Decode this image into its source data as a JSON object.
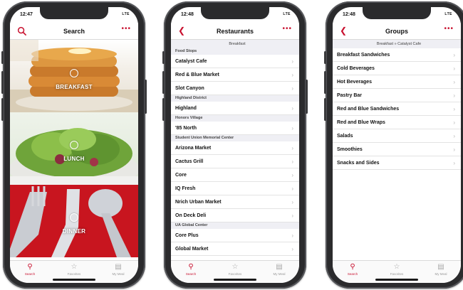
{
  "status": {
    "time_1": "12:47",
    "time_2": "12:48",
    "time_3": "12:48",
    "signal": "LTE"
  },
  "screen1": {
    "title": "Search",
    "meals": [
      {
        "label": "BREAKFAST"
      },
      {
        "label": "LUNCH"
      },
      {
        "label": "DINNER"
      }
    ]
  },
  "screen2": {
    "title": "Restaurants",
    "subheader": "Breakfast",
    "sections": [
      {
        "header": "Food Stops",
        "rows": [
          "Catalyst Cafe",
          "Red & Blue Market",
          "Slot Canyon"
        ]
      },
      {
        "header": "Highland District",
        "rows": [
          "Highland"
        ]
      },
      {
        "header": "Honors Village",
        "rows": [
          "'85 North"
        ]
      },
      {
        "header": "Student Union Memorial Center",
        "rows": [
          "Arizona Market",
          "Cactus Grill",
          "Core",
          "IQ Fresh",
          "Nrich Urban Market",
          "On Deck Deli"
        ]
      },
      {
        "header": "UA Global Center",
        "rows": [
          "Core Plus",
          "Global Market"
        ]
      }
    ]
  },
  "screen3": {
    "title": "Groups",
    "subheader": "Breakfast » Catalyst Cafe",
    "rows": [
      "Breakfast Sandwiches",
      "Cold Beverages",
      "Hot Beverages",
      "Pastry Bar",
      "Red and Blue Sandwiches",
      "Red and Blue Wraps",
      "Salads",
      "Smoothies",
      "Snacks and Sides"
    ]
  },
  "tabbar": {
    "search": "Search",
    "favorites": "Favorites",
    "my_meal": "My Meal"
  },
  "icons": {
    "search": "search-icon",
    "back": "chevron-left-icon",
    "more": "ellipsis-icon",
    "star": "star-icon",
    "meal": "meal-icon"
  },
  "colors": {
    "accent": "#c8102e",
    "phone_frame": "#2b2b2d"
  }
}
